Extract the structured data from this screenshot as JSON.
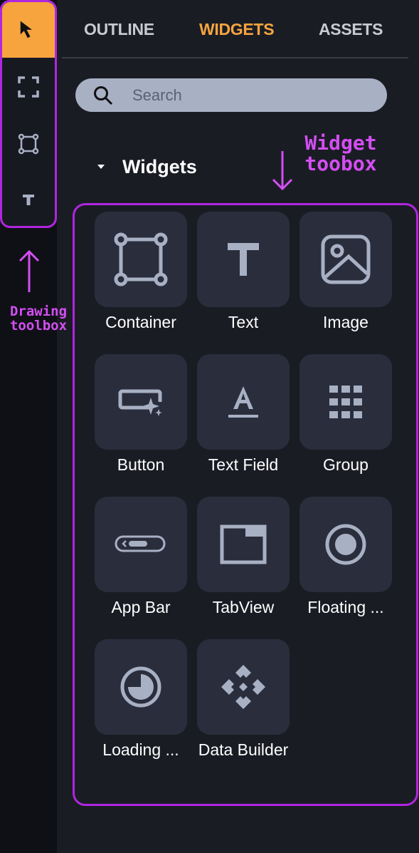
{
  "tabs": [
    {
      "label": "OUTLINE",
      "active": false
    },
    {
      "label": "WIDGETS",
      "active": true
    },
    {
      "label": "ASSETS",
      "active": false
    }
  ],
  "search": {
    "placeholder": "Search",
    "value": ""
  },
  "section": {
    "title": "Widgets",
    "expanded": true
  },
  "drawing_tools": [
    {
      "icon": "select-arrow-icon",
      "active": true
    },
    {
      "icon": "frame-icon",
      "active": false
    },
    {
      "icon": "rectangle-icon",
      "active": false
    },
    {
      "icon": "text-tool-icon",
      "active": false
    }
  ],
  "widgets": [
    {
      "label": "Container",
      "icon": "container-icon"
    },
    {
      "label": "Text",
      "icon": "text-icon"
    },
    {
      "label": "Image",
      "icon": "image-icon"
    },
    {
      "label": "Button",
      "icon": "button-icon"
    },
    {
      "label": "Text Field",
      "icon": "text-field-icon"
    },
    {
      "label": "Group",
      "icon": "group-grid-icon"
    },
    {
      "label": "App Bar",
      "icon": "app-bar-icon"
    },
    {
      "label": "TabView",
      "icon": "tabview-icon"
    },
    {
      "label": "Floating ...",
      "icon": "floating-button-icon"
    },
    {
      "label": "Loading ...",
      "icon": "loading-indicator-icon"
    },
    {
      "label": "Data Builder",
      "icon": "data-builder-icon"
    }
  ],
  "annotations": {
    "drawing": "Drawing\ntoolbox",
    "widget": "Widget\ntoobox"
  },
  "colors": {
    "accent": "#f7a43f",
    "annotation": "#b026e0",
    "tile_bg": "#2a2e3c",
    "icon": "#a8b0c4"
  }
}
